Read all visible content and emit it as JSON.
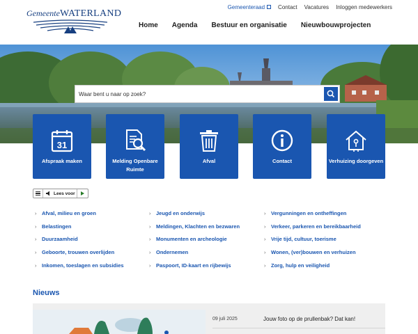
{
  "logo": {
    "part1": "Gemeente",
    "part2": "Waterland"
  },
  "util_nav": {
    "items": [
      "Gemeenteraad",
      "Contact",
      "Vacatures",
      "Inloggen medewerkers"
    ]
  },
  "main_nav": {
    "items": [
      "Home",
      "Agenda",
      "Bestuur en organisatie",
      "Nieuwbouwprojecten"
    ]
  },
  "search": {
    "placeholder": "Waar bent u naar op zoek?",
    "value": ""
  },
  "calendar_day": "31",
  "tiles": [
    {
      "label": "Afspraak maken",
      "icon": "calendar-icon"
    },
    {
      "label": "Melding Openbare Ruimte",
      "icon": "document-search-icon"
    },
    {
      "label": "Afval",
      "icon": "trash-icon"
    },
    {
      "label": "Contact",
      "icon": "info-icon"
    },
    {
      "label": "Verhuizing doorgeven",
      "icon": "house-icon"
    }
  ],
  "readspeaker": {
    "label": "Lees voor"
  },
  "topics": [
    [
      "Afval, milieu en groen",
      "Belastingen",
      "Duurzaamheid",
      "Geboorte, trouwen overlijden",
      "Inkomen, toeslagen en subsidies"
    ],
    [
      "Jeugd en onderwijs",
      "Meldingen, Klachten en bezwaren",
      "Monumenten en archeologie",
      "Ondernemen",
      "Paspoort, ID-kaart en rijbewijs"
    ],
    [
      "Vergunningen en ontheffingen",
      "Verkeer, parkeren en bereikbaarheid",
      "Vrije tijd, cultuur, toerisme",
      "Wonen, (ver)bouwen en verhuizen",
      "Zorg, hulp en veiligheid"
    ]
  ],
  "news": {
    "title": "Nieuws",
    "items": [
      {
        "date": "09 juli 2025",
        "headline": "Jouw foto op de prullenbak? Dat kan!"
      }
    ]
  },
  "colors": {
    "brand_blue": "#1a56b0"
  }
}
